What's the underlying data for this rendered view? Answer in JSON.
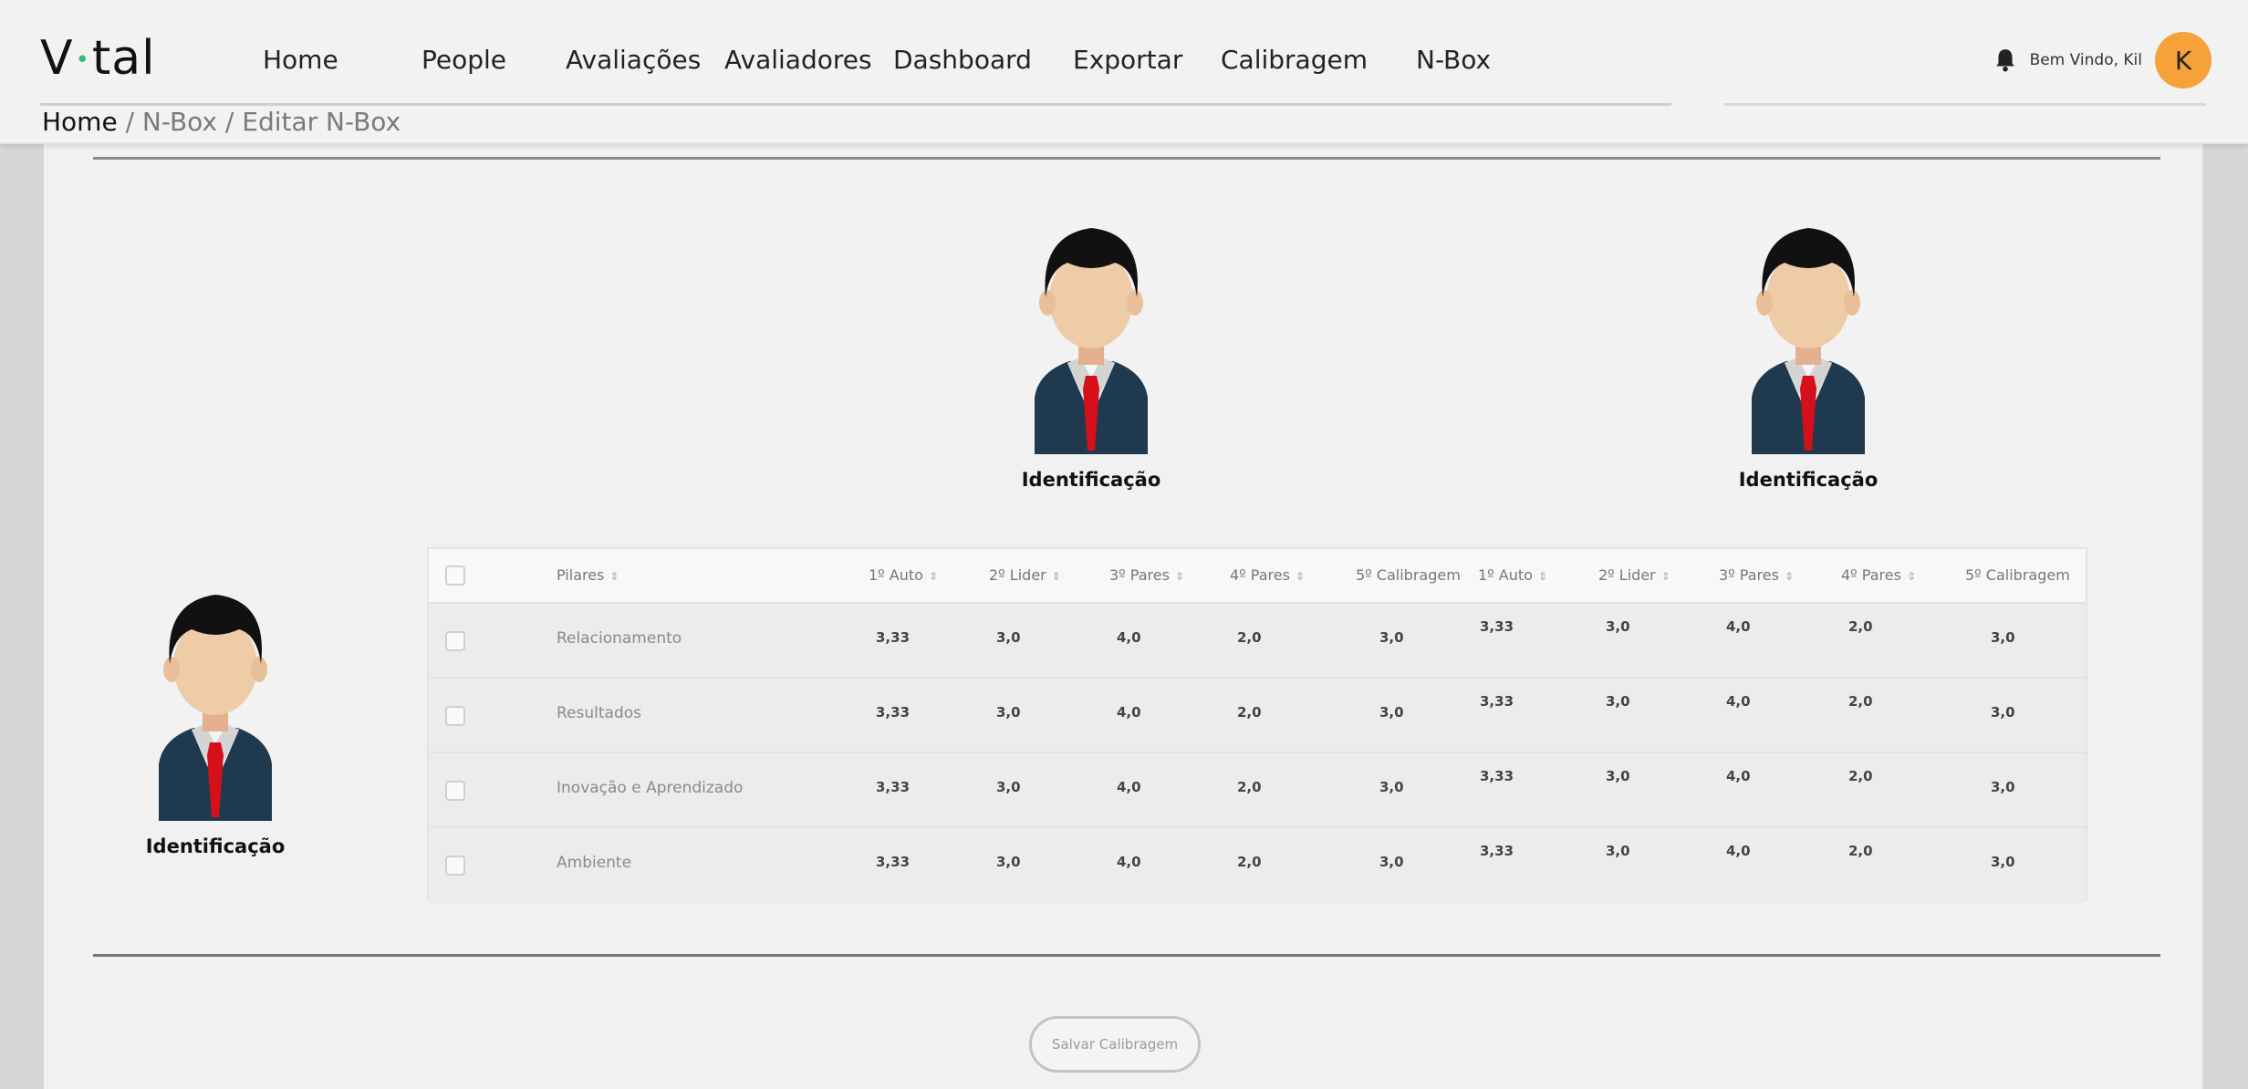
{
  "header": {
    "logo": {
      "left": "V",
      "right": "tal"
    },
    "nav": [
      {
        "label": "Home"
      },
      {
        "label": "People"
      },
      {
        "label": "Avaliações"
      },
      {
        "label": "Avaliadores"
      },
      {
        "label": "Dashboard"
      },
      {
        "label": "Exportar"
      },
      {
        "label": "Calibragem"
      },
      {
        "label": "N-Box"
      }
    ],
    "welcome": "Bem Vindo, Kil",
    "avatar_initial": "K",
    "icons": {
      "notification": "bell-icon"
    },
    "colors": {
      "avatar": "#f7a13a",
      "logo_dot": "#2fbf71"
    }
  },
  "breadcrumb": {
    "home": "Home",
    "rest": " / N-Box / Editar N-Box"
  },
  "people": [
    {
      "name": "Identificação"
    },
    {
      "name": "Identificação"
    },
    {
      "name": "Identificação"
    }
  ],
  "table": {
    "headers": [
      "Pilares",
      "1º Auto",
      "2º Lider",
      "3º Pares",
      "4º Pares",
      "5º Calibragem",
      "1º Auto",
      "2º Lider",
      "3º Pares",
      "4º Pares",
      "5º Calibragem"
    ],
    "rows": [
      {
        "pilar": "Relacionamento",
        "values": [
          "3,33",
          "3,0",
          "4,0",
          "2,0",
          "3,0",
          "3,33",
          "3,0",
          "4,0",
          "2,0",
          "3,0"
        ]
      },
      {
        "pilar": "Resultados",
        "values": [
          "3,33",
          "3,0",
          "4,0",
          "2,0",
          "3,0",
          "3,33",
          "3,0",
          "4,0",
          "2,0",
          "3,0"
        ]
      },
      {
        "pilar": "Inovação e Aprendizado",
        "values": [
          "3,33",
          "3,0",
          "4,0",
          "2,0",
          "3,0",
          "3,33",
          "3,0",
          "4,0",
          "2,0",
          "3,0"
        ]
      },
      {
        "pilar": "Ambiente",
        "values": [
          "3,33",
          "3,0",
          "4,0",
          "2,0",
          "3,0",
          "3,33",
          "3,0",
          "4,0",
          "2,0",
          "3,0"
        ]
      }
    ],
    "colors": {
      "calibragem_highlight": "#fdecec"
    }
  },
  "actions": {
    "save_label": "Salvar Calibragem"
  }
}
